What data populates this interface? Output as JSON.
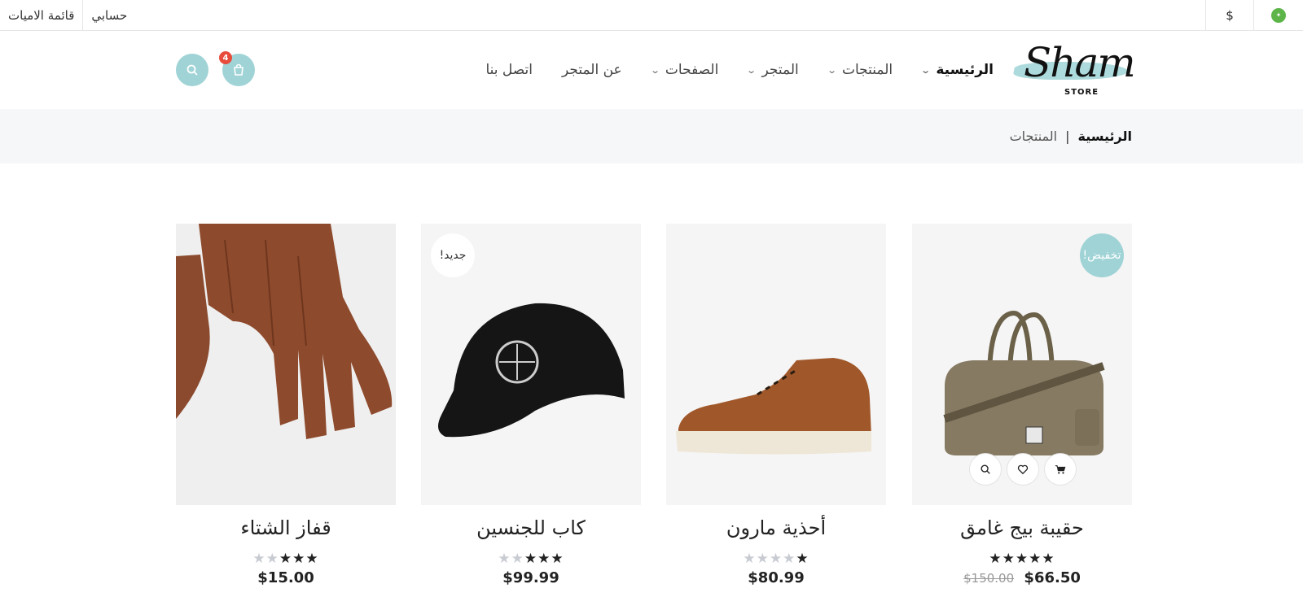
{
  "topbar": {
    "links": [
      "قائمة الاميات",
      "حسابي"
    ],
    "currency": "$",
    "flag_icon": "flag-icon"
  },
  "header": {
    "logo_script": "Sham",
    "logo_sub": "STORE",
    "nav": [
      {
        "label": "الرئيسية",
        "has_dropdown": true,
        "active": true
      },
      {
        "label": "المنتجات",
        "has_dropdown": true,
        "active": false
      },
      {
        "label": "المتجر",
        "has_dropdown": true,
        "active": false
      },
      {
        "label": "الصفحات",
        "has_dropdown": true,
        "active": false
      },
      {
        "label": "عن المتجر",
        "has_dropdown": false,
        "active": false
      },
      {
        "label": "اتصل بنا",
        "has_dropdown": false,
        "active": false
      }
    ],
    "cart_count": "4",
    "accent_color": "#9fd3d6"
  },
  "breadcrumb": {
    "home": "الرئيسية",
    "separator": "|",
    "current": "المنتجات"
  },
  "products": [
    {
      "name": "حقيبة بيج غامق",
      "rating": 4.5,
      "price": "$66.50",
      "old_price": "$150.00",
      "tag": "تخفيض!",
      "tag_type": "sale",
      "image": "duffel-bag-image"
    },
    {
      "name": "أحذية مارون",
      "rating": 1,
      "price": "$80.99",
      "old_price": "",
      "tag": "",
      "tag_type": "",
      "image": "brown-sneaker-image"
    },
    {
      "name": "كاب للجنسين",
      "rating": 3.5,
      "price": "$99.99",
      "old_price": "",
      "tag": "جديد!",
      "tag_type": "new",
      "image": "black-cap-image"
    },
    {
      "name": "قفاز الشتاء",
      "rating": 3,
      "price": "$15.00",
      "old_price": "",
      "tag": "",
      "tag_type": "",
      "image": "leather-gloves-image"
    }
  ]
}
